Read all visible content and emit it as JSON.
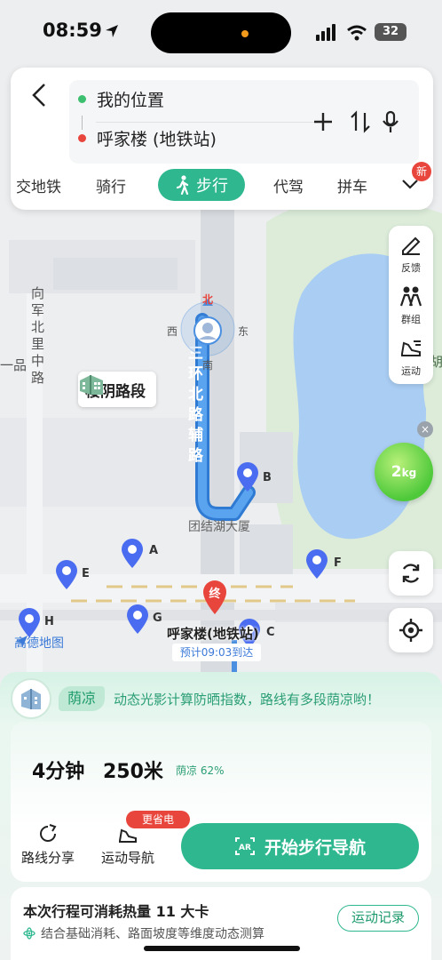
{
  "status_bar": {
    "time": "08:59",
    "battery": "32"
  },
  "route_search": {
    "origin": "我的位置",
    "destination": "呼家楼 (地铁站)"
  },
  "modes": {
    "items": [
      "交地铁",
      "骑行",
      "步行",
      "代驾",
      "拼车"
    ],
    "active": "步行",
    "new_badge": "新"
  },
  "tools": {
    "feedback": "反馈",
    "group": "群组",
    "sport": "运动",
    "calorie_badge_value": "2",
    "calorie_badge_unit": "kg",
    "close": "×"
  },
  "map": {
    "compass": {
      "north": "北",
      "south": "南",
      "east": "东",
      "west": "西"
    },
    "landmark": "楼阴路段",
    "route_road": "三环北路辅路",
    "street_left": "向军北里中路",
    "street_left2": "一品",
    "building": "团结湖大厦",
    "pins": [
      "A",
      "B",
      "C",
      "E",
      "F",
      "G",
      "H"
    ],
    "destination_marker": "终",
    "destination_name": "呼家楼(地铁站)",
    "eta": "预计09:03到达",
    "logo": "高德地图",
    "edge_text_right": "胡"
  },
  "bottom": {
    "shade_tag": "荫凉",
    "shade_desc": "动态光影计算防晒指数，路线有多段荫凉哟！",
    "duration": "4分钟",
    "distance": "250米",
    "shade_pct": "荫凉 62%",
    "share_label": "路线分享",
    "sport_nav_label": "运动导航",
    "save_badge": "更省电",
    "start_label": "开始步行导航",
    "calorie_title": "本次行程可消耗热量 11 大卡",
    "calorie_sub": "结合基础消耗、路面坡度等维度动态测算",
    "record_label": "运动记录"
  },
  "colors": {
    "accent": "#2fb88f",
    "route": "#4a8fe0",
    "pin": "#4a6cf0",
    "destination": "#e8453c",
    "park": "#dcecd9",
    "water": "#a9cdf3"
  }
}
